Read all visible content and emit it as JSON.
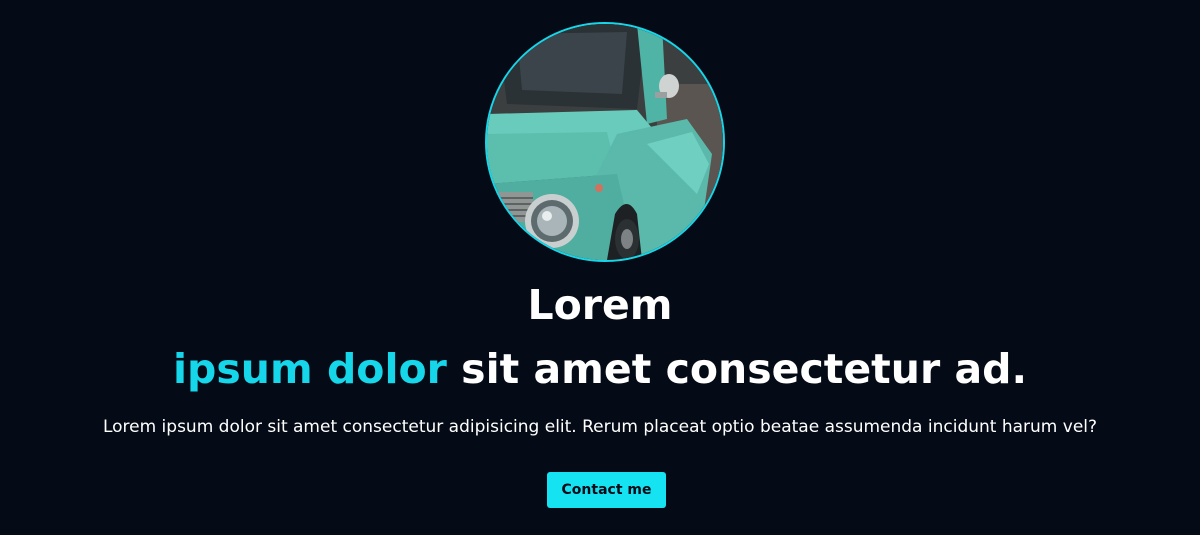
{
  "hero": {
    "title_line1": "Lorem",
    "title_accent": "ipsum dolor",
    "title_rest": " sit amet consectetur ad.",
    "subtitle": "Lorem ipsum dolor sit amet consectetur adipisicing elit. Rerum placeat optio beatae assumenda incidunt harum vel?",
    "cta_label": "Contact me"
  },
  "colors": {
    "background": "#050b16",
    "accent": "#16d6ea",
    "button": "#16e3f2",
    "text": "#ffffff"
  },
  "image": {
    "subject": "turquoise-vintage-car-photo"
  }
}
